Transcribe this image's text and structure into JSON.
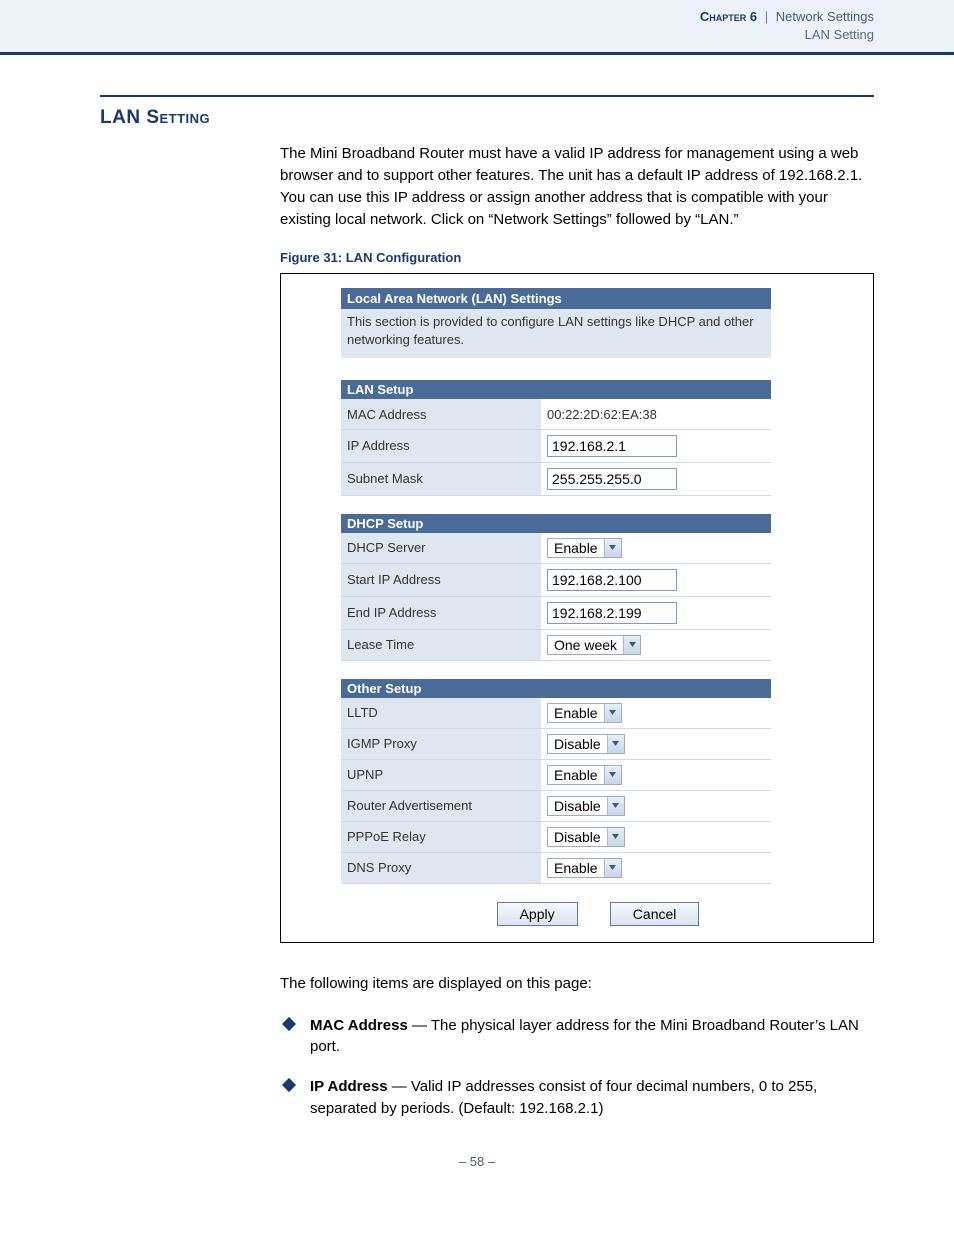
{
  "header": {
    "chapter_label": "Chapter 6",
    "separator": "|",
    "breadcrumb": "Network Settings",
    "subcrumb": "LAN Setting"
  },
  "section": {
    "title": "LAN Setting",
    "intro": "The Mini Broadband Router must have a valid IP address for management using a web browser and to support other features. The unit has a default IP address of 192.168.2.1. You can use this IP address or assign another address that is compatible with your existing local network. Click on “Network Settings” followed by “LAN.”"
  },
  "figure": {
    "caption": "Figure 31:  LAN Configuration",
    "panel_title": "Local Area Network (LAN) Settings",
    "panel_desc": "This section is provided to configure LAN settings like DHCP and other networking features.",
    "lan_setup": {
      "heading": "LAN Setup",
      "rows": {
        "mac_label": "MAC Address",
        "mac_value": "00:22:2D:62:EA:38",
        "ip_label": "IP Address",
        "ip_value": "192.168.2.1",
        "subnet_label": "Subnet Mask",
        "subnet_value": "255.255.255.0"
      }
    },
    "dhcp_setup": {
      "heading": "DHCP Setup",
      "rows": {
        "server_label": "DHCP Server",
        "server_value": "Enable",
        "start_label": "Start IP Address",
        "start_value": "192.168.2.100",
        "end_label": "End IP Address",
        "end_value": "192.168.2.199",
        "lease_label": "Lease Time",
        "lease_value": "One week"
      }
    },
    "other_setup": {
      "heading": "Other Setup",
      "rows": {
        "lltd_label": "LLTD",
        "lltd_value": "Enable",
        "igmp_label": "IGMP Proxy",
        "igmp_value": "Disable",
        "upnp_label": "UPNP",
        "upnp_value": "Enable",
        "ra_label": "Router Advertisement",
        "ra_value": "Disable",
        "pppoe_label": "PPPoE Relay",
        "pppoe_value": "Disable",
        "dns_label": "DNS Proxy",
        "dns_value": "Enable"
      }
    },
    "buttons": {
      "apply": "Apply",
      "cancel": "Cancel"
    }
  },
  "after_figure": {
    "lead": "The following items are displayed on this page:",
    "items": [
      {
        "term": "MAC Address",
        "desc": " — The physical layer address for the Mini Broadband Router’s LAN port."
      },
      {
        "term": "IP Address",
        "desc": " — Valid IP addresses consist of four decimal numbers, 0 to 255, separated by periods. (Default: 192.168.2.1)"
      }
    ]
  },
  "footer": {
    "page": "–  58  –"
  }
}
